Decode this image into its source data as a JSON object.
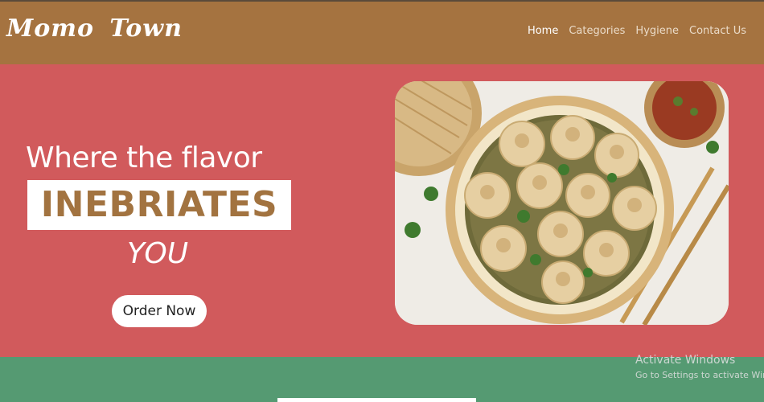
{
  "brand": {
    "logo": "Momo  Town"
  },
  "nav": {
    "items": [
      {
        "label": "Home",
        "active": true
      },
      {
        "label": "Categories",
        "active": false
      },
      {
        "label": "Hygiene",
        "active": false
      },
      {
        "label": "Contact Us",
        "active": false
      }
    ]
  },
  "hero": {
    "line1": "Where the flavor",
    "line2": "INEBRIATES",
    "line3": "YOU",
    "cta": "Order Now"
  },
  "watermark": {
    "title": "Activate Windows",
    "subtitle": "Go to Settings to activate Windows."
  },
  "colors": {
    "navbar": "#a57340",
    "hero": "#d15a5c",
    "footer": "#559a72",
    "accent_text": "#a27340"
  },
  "icons": [
    "dumplings-photo"
  ]
}
